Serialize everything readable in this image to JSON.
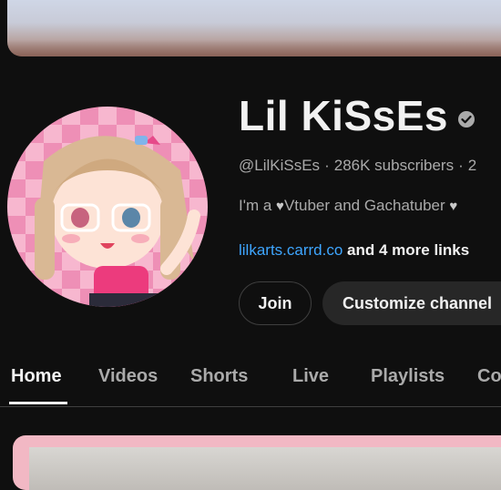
{
  "channel": {
    "name": "Lil KiSsEs",
    "verified_icon": "verified-check-icon",
    "handle": "@LilKiSsEs",
    "subscribers": "286K subscribers",
    "meta_overflow": "2",
    "description_parts": [
      "I'm a ",
      "Vtuber and Gachatuber "
    ],
    "link_text": "lilkarts.carrd.co",
    "more_links": " and 4 more links"
  },
  "buttons": {
    "join": "Join",
    "customize": "Customize channel"
  },
  "tabs": [
    "Home",
    "Videos",
    "Shorts",
    "Live",
    "Playlists",
    "Co"
  ],
  "active_tab": "Home",
  "colors": {
    "background": "#0f0f0f",
    "link": "#3ea6ff",
    "muted_text": "#aaaaaa",
    "button_bg": "#272727"
  }
}
